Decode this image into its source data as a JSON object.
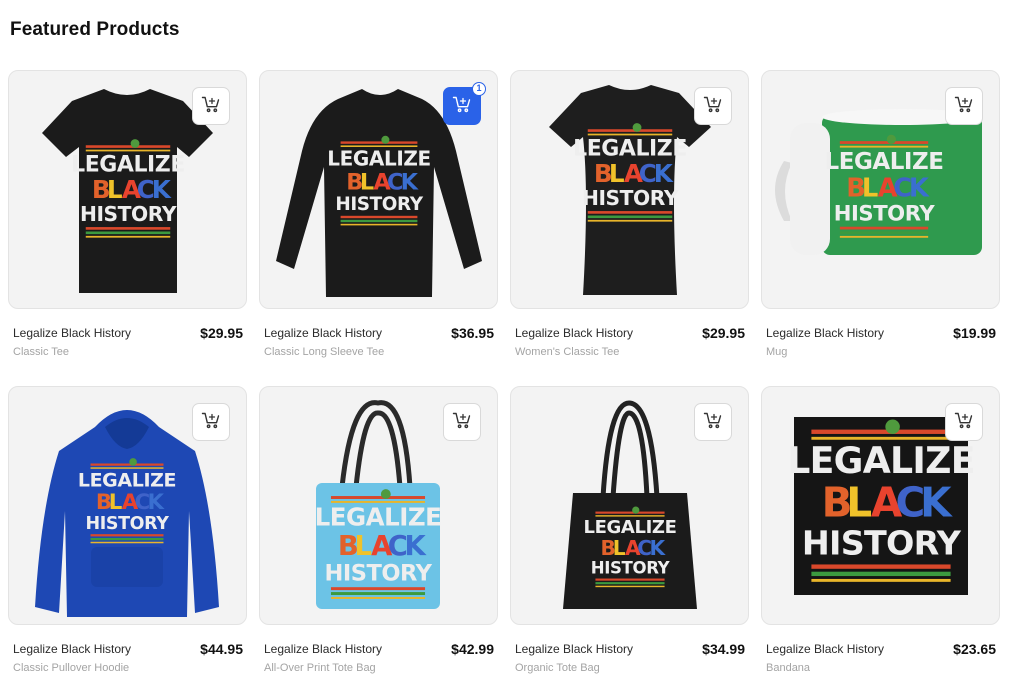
{
  "section": {
    "title": "Featured Products"
  },
  "design": {
    "line1": "LEGALIZE",
    "line2_letters": [
      "B",
      "L",
      "A",
      "C",
      "K"
    ],
    "line3": "HISTORY"
  },
  "products": [
    {
      "name": "Legalize Black History",
      "type": "Classic Tee",
      "price": "$29.95",
      "cart_count": "",
      "garment": "tshirt",
      "color": "#1b1b1b"
    },
    {
      "name": "Legalize Black History",
      "type": "Classic Long Sleeve Tee",
      "price": "$36.95",
      "cart_count": "1",
      "garment": "longsleeve",
      "color": "#1b1b1b"
    },
    {
      "name": "Legalize Black History",
      "type": "Women's Classic Tee",
      "price": "$29.95",
      "cart_count": "",
      "garment": "womens",
      "color": "#1e1e1e"
    },
    {
      "name": "Legalize Black History",
      "type": "Mug",
      "price": "$19.99",
      "cart_count": "",
      "garment": "mug",
      "color": "#2f9a4e"
    },
    {
      "name": "Legalize Black History",
      "type": "Classic Pullover Hoodie",
      "price": "$44.95",
      "cart_count": "",
      "garment": "hoodie",
      "color": "#1e48b4"
    },
    {
      "name": "Legalize Black History",
      "type": "All-Over Print Tote Bag",
      "price": "$42.99",
      "cart_count": "",
      "garment": "tote-print",
      "color": "#6cc3e6"
    },
    {
      "name": "Legalize Black History",
      "type": "Organic Tote Bag",
      "price": "$34.99",
      "cart_count": "",
      "garment": "tote",
      "color": "#1b1b1b"
    },
    {
      "name": "Legalize Black History",
      "type": "Bandana",
      "price": "$23.65",
      "cart_count": "",
      "garment": "bandana",
      "color": "#151515"
    }
  ],
  "colors": {
    "accent": "#2a62e8",
    "letter_colors": [
      "#e2622b",
      "#f0c22a",
      "#e8432e",
      "#3f63c9",
      "#3a6fd0"
    ]
  },
  "icons": {
    "cart": "add-to-cart-icon"
  }
}
